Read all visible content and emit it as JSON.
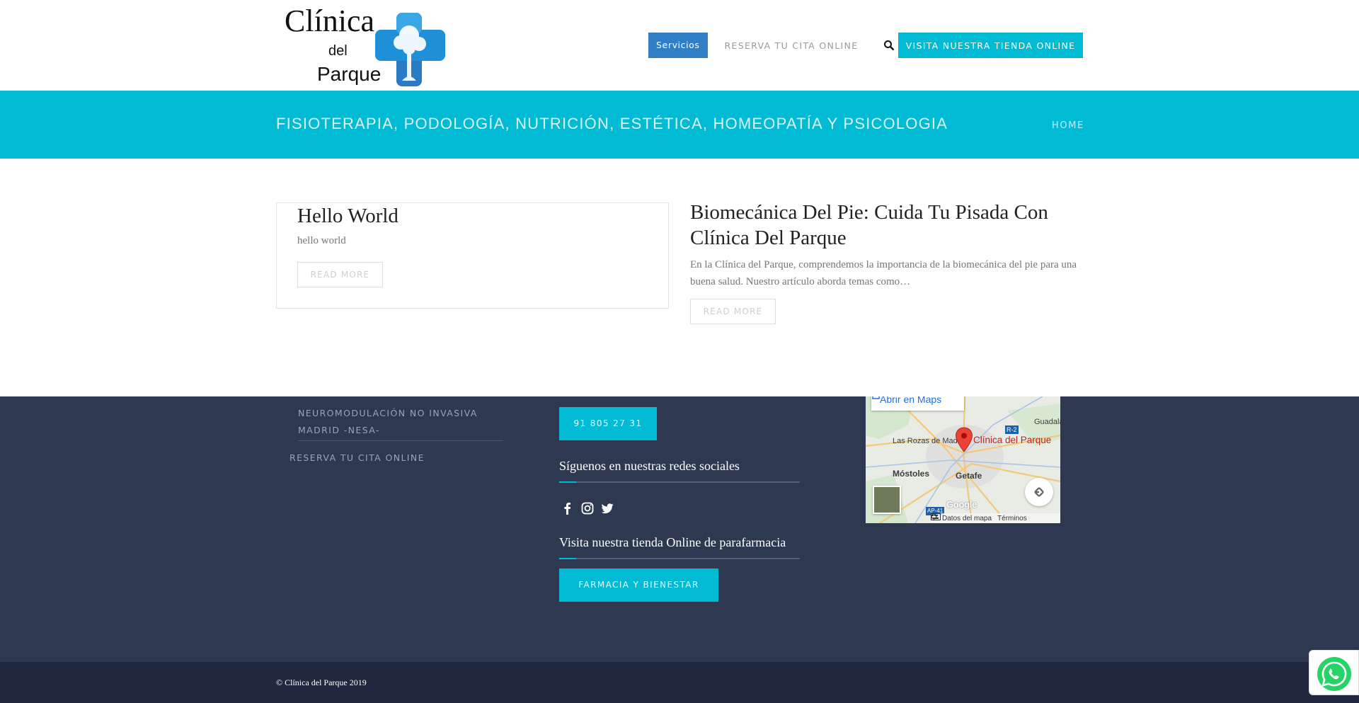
{
  "header": {
    "logo": {
      "line1": "Clínica",
      "line2": "del",
      "line3": "Parque"
    },
    "nav": {
      "servicios": "Servicios",
      "reserva": "RESERVA TU CITA ONLINE",
      "shop": "VISITA NUESTRA TIENDA ONLINE"
    }
  },
  "band": {
    "title": "FISIOTERAPIA, PODOLOGÍA, NUTRICIÓN, ESTÉTICA, HOMEOPATÍA Y PSICOLOGIA",
    "breadcrumb": "HOME"
  },
  "posts": [
    {
      "title": "Hello World",
      "excerpt": "hello world",
      "read_more": "READ MORE"
    },
    {
      "title": "Biomecánica Del Pie: Cuida Tu Pisada Con Clínica Del Parque",
      "excerpt": "En la Clínica del Parque, comprendemos la importancia de la biomecánica del pie para una buena salud. Nuestro artículo aborda temas como…",
      "read_more": "READ MORE"
    }
  ],
  "footer": {
    "services_item": "NEUROMODULACIÓN NO INVASIVA MADRID -NESA-",
    "reserva": "RESERVA TU CITA ONLINE",
    "phone": "91 805 27 31",
    "social_heading": "Síguenos en nuestras redes sociales",
    "social_icons": [
      "facebook-icon",
      "instagram-icon",
      "twitter-icon"
    ],
    "shop_heading": "Visita nuestra tienda Online de parafarmacia",
    "shop_button": "FARMACIA Y BIENESTAR",
    "map": {
      "open_in_maps": "Abrir en Maps",
      "place": "Clínica del Parque",
      "labels": {
        "las_rozas": "Las Rozas de Madrid",
        "mostoles": "Móstoles",
        "getafe": "Getafe",
        "guadala": "Guadala",
        "r2": "R-2",
        "a41": "AP-41"
      },
      "google": "Google",
      "map_data": "Datos del mapa",
      "terms": "Términos"
    }
  },
  "copyright": "© Clínica del Parque 2019",
  "colors": {
    "accent": "#00bbd3",
    "nav_active": "#2f7ec6",
    "footer_bg": "#2e3850",
    "bottom_bg": "#1f283e",
    "whatsapp": "#25d366"
  }
}
